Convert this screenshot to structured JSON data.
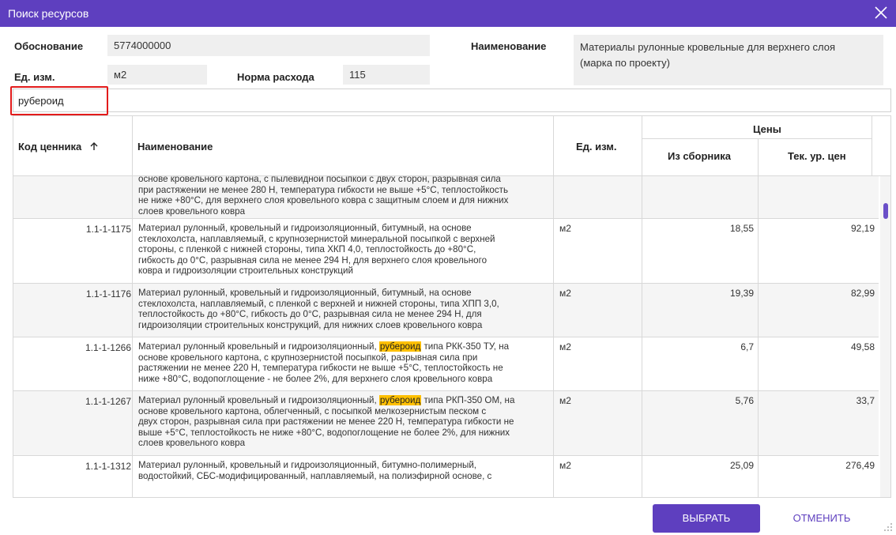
{
  "window": {
    "title": "Поиск ресурсов",
    "accent": "#5e3fbf",
    "highlight": "#ffc000",
    "search_marker": "#e21b1b"
  },
  "form": {
    "basis_label": "Обоснование",
    "basis_value": "5774000000",
    "name_label": "Наименование",
    "name_value_line1": "Материалы рулонные кровельные для верхнего слоя",
    "name_value_line2": "(марка по проекту)",
    "unit_label": "Ед. изм.",
    "unit_value": "м2",
    "norm_label": "Норма расхода",
    "norm_value": "115"
  },
  "search": {
    "value": "рубероид"
  },
  "table": {
    "headers": {
      "code": "Код ценника",
      "name": "Наименование",
      "unit": "Ед. изм.",
      "prices": "Цены",
      "from_collection": "Из сборника",
      "current_level": "Тек. ур. цен"
    },
    "sort_icon": "arrow-up-icon",
    "rows": [
      {
        "code": "",
        "name": [
          "основе кровельного картона, с пылевидной посыпкой с двух сторон, разрывная сила",
          "при растяжении не менее 280 Н, температура гибкости не выше +5°С, теплостойкость",
          "не ниже +80°С, для верхнего слоя кровельного ковра с защитным слоем и для нижних",
          "слоев кровельного ковра"
        ],
        "unit": "",
        "price_collection": "",
        "price_current": ""
      },
      {
        "code": "1.1-1-1175",
        "name": [
          "Материал рулонный, кровельный и гидроизоляционный, битумный, на основе",
          "стеклохолста, наплавляемый, с крупнозернистой минеральной посыпкой с верхней",
          "стороны, с пленкой с нижней стороны, типа ХКП 4,0, теплостойкость до +80°С,",
          "гибкость до 0°С, разрывная сила не менее 294 Н, для верхнего слоя кровельного",
          "ковра и гидроизоляции строительных конструкций"
        ],
        "unit": "м2",
        "price_collection": "18,55",
        "price_current": "92,19"
      },
      {
        "code": "1.1-1-1176",
        "name": [
          "Материал рулонный, кровельный и гидроизоляционный, битумный, на основе",
          "стеклохолста, наплавляемый, с пленкой с верхней и нижней стороны, типа ХПП 3,0,",
          "теплостойкость до +80°С, гибкость до 0°С, разрывная сила не менее 294 Н, для",
          "гидроизоляции строительных конструкций, для нижних слоев кровельного ковра"
        ],
        "unit": "м2",
        "price_collection": "19,39",
        "price_current": "82,99"
      },
      {
        "code": "1.1-1-1266",
        "name_pre": "Материал рулонный кровельный и гидроизоляционный, ",
        "name_hl": "рубероид",
        "name_post": " типа РКК-350 ТУ, на",
        "name": [
          "основе кровельного картона, с крупнозернистой посыпкой, разрывная сила при",
          "растяжении не менее 220 Н, температура гибкости не выше +5°С, теплостойкость не",
          "ниже +80°С, водопоглощение - не более 2%, для верхнего слоя кровельного ковра"
        ],
        "unit": "м2",
        "price_collection": "6,7",
        "price_current": "49,58"
      },
      {
        "code": "1.1-1-1267",
        "name_pre": "Материал рулонный кровельный и гидроизоляционный, ",
        "name_hl": "рубероид",
        "name_post": " типа РКП-350 ОМ, на",
        "name": [
          "основе кровельного картона, облегченный, с посыпкой мелкозернистым песком с",
          "двух сторон, разрывная сила при растяжении не менее 220 Н, температура гибкости не",
          "выше +5°С, теплостойкость не ниже +80°С, водопоглощение не более 2%, для нижних",
          "слоев кровельного ковра"
        ],
        "unit": "м2",
        "price_collection": "5,76",
        "price_current": "33,7"
      },
      {
        "code": "1.1-1-1312",
        "name": [
          "Материал рулонный, кровельный и гидроизоляционный, битумно-полимерный,",
          "водостойкий, СБС-модифицированный, наплавляемый, на полиэфирной основе, с"
        ],
        "unit": "м2",
        "price_collection": "25,09",
        "price_current": "276,49"
      }
    ]
  },
  "actions": {
    "select": "ВЫБРАТЬ",
    "cancel": "ОТМЕНИТЬ"
  }
}
